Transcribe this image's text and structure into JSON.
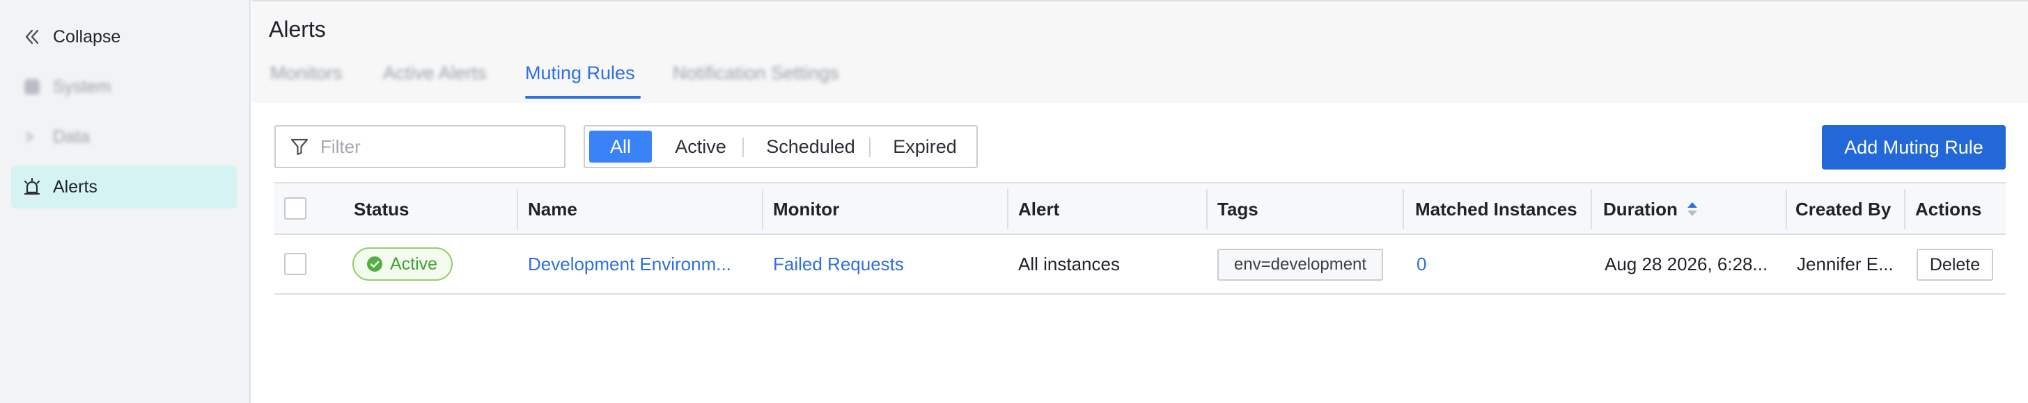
{
  "sidebar": {
    "collapse_label": "Collapse",
    "items": [
      {
        "label": "System"
      },
      {
        "label": "Data"
      },
      {
        "label": "Alerts"
      }
    ]
  },
  "page": {
    "title": "Alerts",
    "tabs": [
      {
        "label": "Monitors"
      },
      {
        "label": "Active Alerts"
      },
      {
        "label": "Muting Rules"
      },
      {
        "label": "Notification Settings"
      }
    ],
    "active_tab": "Muting Rules"
  },
  "toolbar": {
    "filter_placeholder": "Filter",
    "segments": [
      "All",
      "Active",
      "Scheduled",
      "Expired"
    ],
    "active_segment": "All",
    "add_button_label": "Add Muting Rule"
  },
  "table": {
    "columns": [
      "Status",
      "Name",
      "Monitor",
      "Alert",
      "Tags",
      "Matched Instances",
      "Duration",
      "Created By",
      "Actions"
    ],
    "sorted_column": "Duration",
    "rows": [
      {
        "status": "Active",
        "name": "Development Environm...",
        "monitor": "Failed Requests",
        "alert": "All instances",
        "tag": "env=development",
        "matched_instances": "0",
        "duration": "Aug 28 2026, 6:28...",
        "created_by": "Jennifer E...",
        "action_label": "Delete"
      }
    ]
  },
  "colors": {
    "accent": "#2f6fe0",
    "primary_button": "#2368d8",
    "active_segment": "#3a82f7",
    "sidebar_active": "#d5f3f2",
    "status_active": "#3fa333"
  }
}
